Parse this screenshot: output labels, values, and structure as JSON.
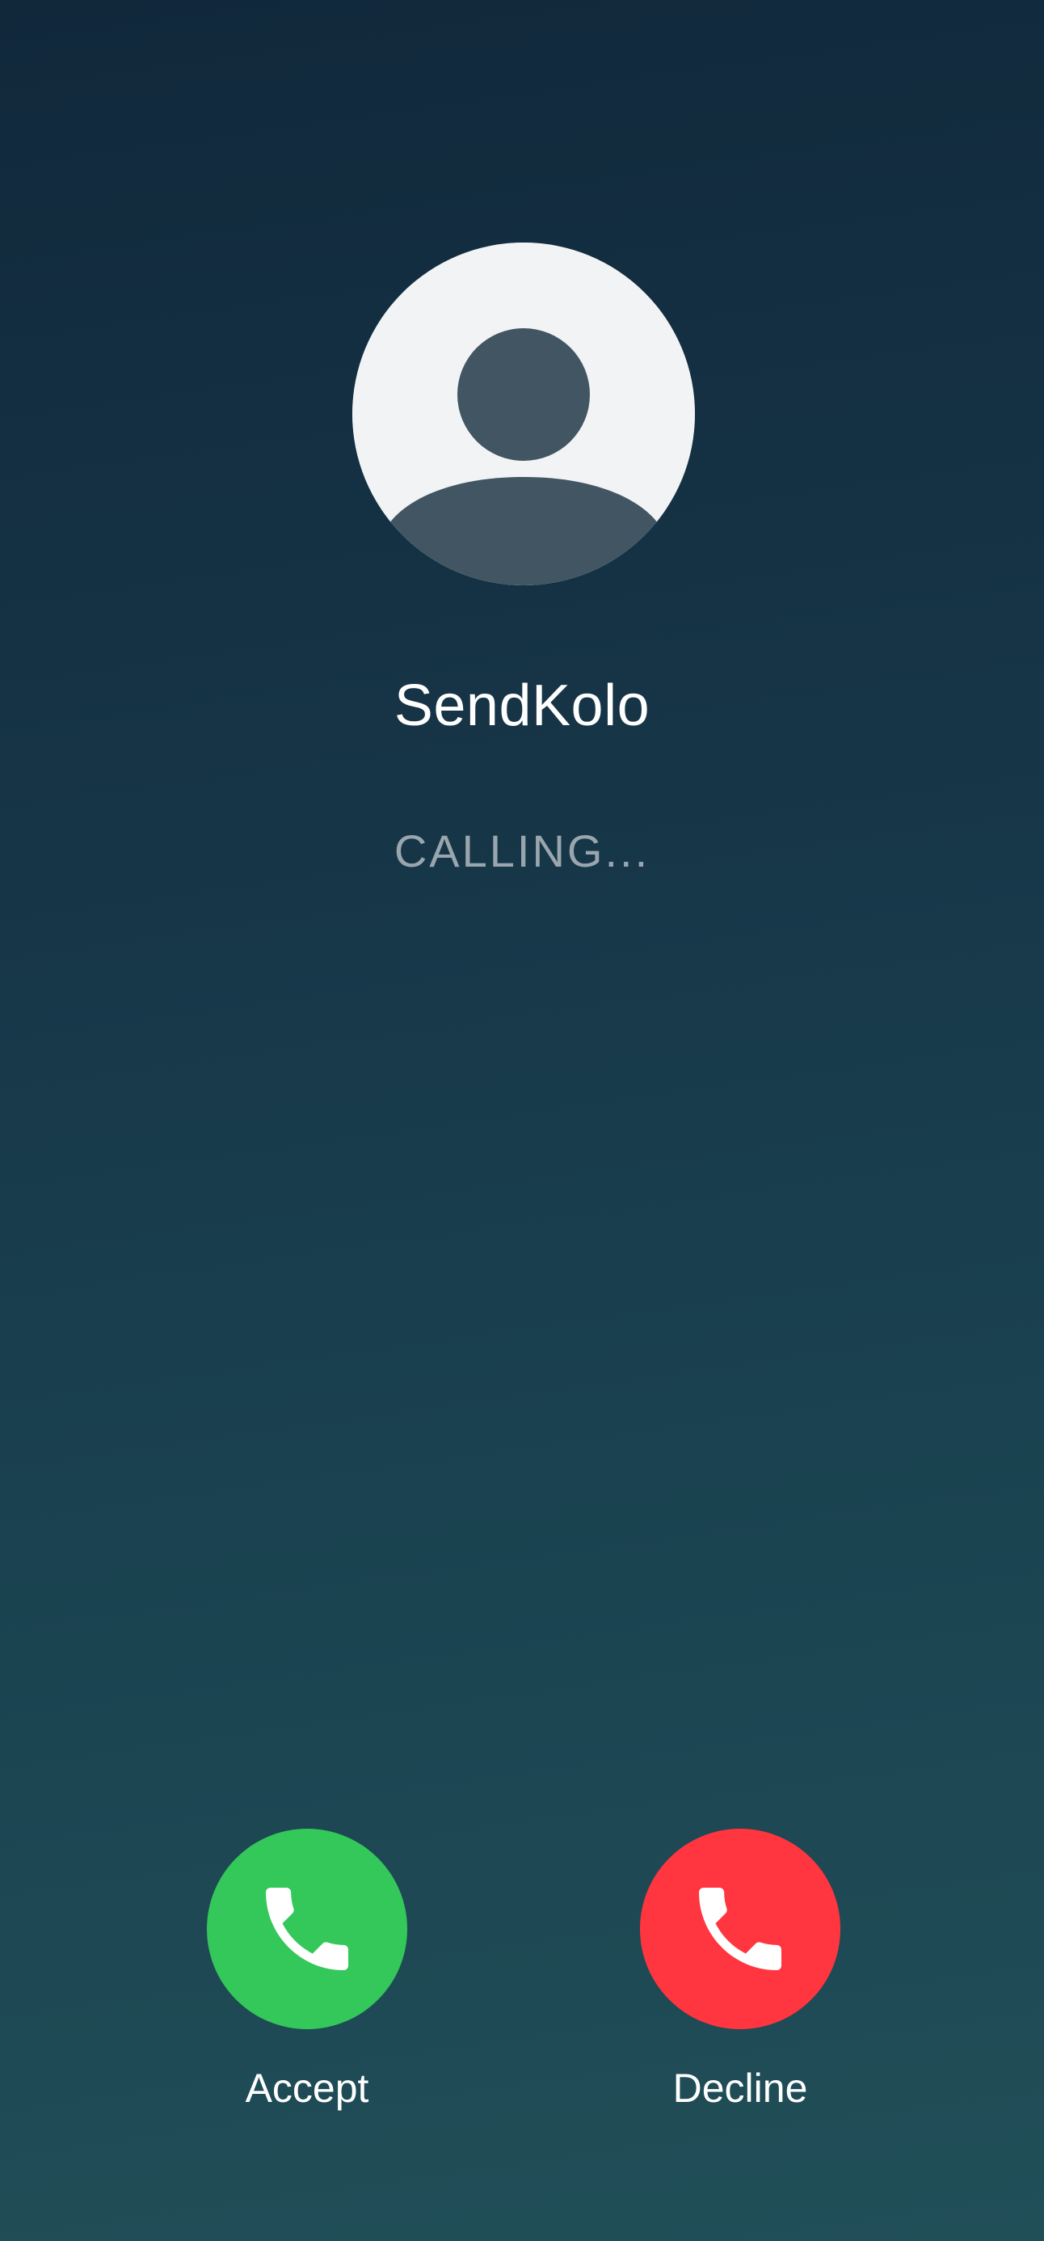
{
  "caller": {
    "name": "SendKolo",
    "status": "CALLING..."
  },
  "actions": {
    "accept_label": "Accept",
    "decline_label": "Decline",
    "accept_color": "#34c75a",
    "decline_color": "#ff3640"
  },
  "icons": {
    "avatar": "person-silhouette-icon",
    "accept": "phone-icon",
    "decline": "phone-icon"
  }
}
